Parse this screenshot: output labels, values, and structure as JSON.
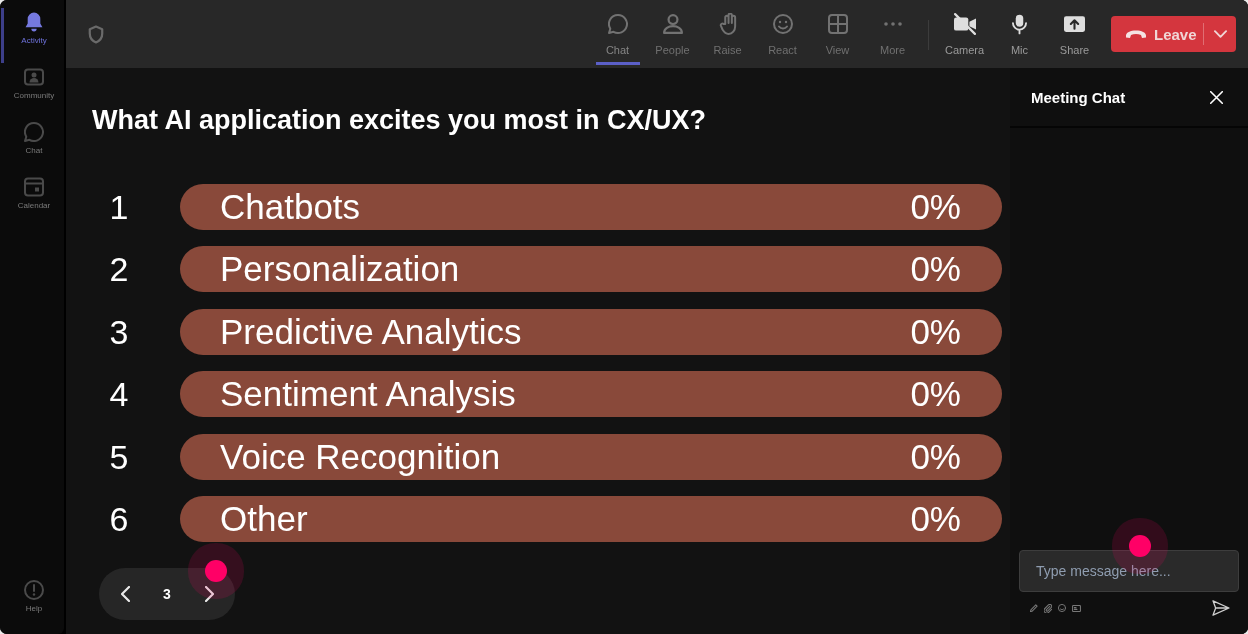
{
  "sidebar": {
    "items": [
      {
        "label": "Activity",
        "selected": true
      },
      {
        "label": "Community",
        "selected": false
      },
      {
        "label": "Chat",
        "selected": false
      },
      {
        "label": "Calendar",
        "selected": false
      }
    ],
    "help": {
      "label": "Help"
    }
  },
  "toolbar": {
    "meeting_tools": [
      {
        "label": "Chat",
        "selected": true
      },
      {
        "label": "People",
        "selected": false
      },
      {
        "label": "Raise",
        "selected": false
      },
      {
        "label": "React",
        "selected": false
      },
      {
        "label": "View",
        "selected": false
      },
      {
        "label": "More",
        "selected": false
      }
    ],
    "camera": {
      "label": "Camera",
      "on": false
    },
    "mic": {
      "label": "Mic",
      "on": true
    },
    "share": {
      "label": "Share"
    },
    "leave_button": {
      "label": "Leave"
    }
  },
  "poll": {
    "question": "What AI application excites you most in CX/UX?",
    "options": [
      {
        "number": "1",
        "label": "Chatbots",
        "result": "0%"
      },
      {
        "number": "2",
        "label": "Personalization",
        "result": "0%"
      },
      {
        "number": "3",
        "label": "Predictive Analytics",
        "result": "0%"
      },
      {
        "number": "4",
        "label": "Sentiment Analysis",
        "result": "0%"
      },
      {
        "number": "5",
        "label": "Voice Recognition",
        "result": "0%"
      },
      {
        "number": "6",
        "label": "Other",
        "result": "0%"
      }
    ],
    "pager": {
      "page": "3"
    }
  },
  "chat_panel": {
    "title": "Meeting Chat",
    "message_input": {
      "placeholder": "Type message here..."
    }
  }
}
